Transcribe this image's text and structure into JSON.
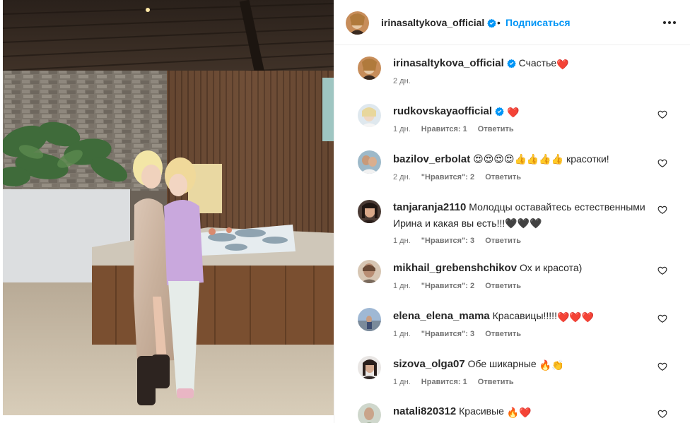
{
  "header": {
    "username": "irinasaltykova_official",
    "follow_label": "Подписаться",
    "separator": "•"
  },
  "comments": [
    {
      "username": "irinasaltykova_official",
      "text": "Счастье",
      "emoji": "❤️",
      "time": "2 дн.",
      "likes": "",
      "reply": "",
      "verified": true,
      "caption": true
    },
    {
      "username": "rudkovskayaofficial",
      "text": "",
      "emoji": "❤️",
      "time": "1 дн.",
      "likes": "Нравится: 1",
      "reply": "Ответить",
      "verified": true
    },
    {
      "username": "bazilov_erbolat",
      "text": "😍😍😍😍👍👍👍👍 красотки!",
      "emoji": "",
      "time": "2 дн.",
      "likes": "\"Нравится\": 2",
      "reply": "Ответить"
    },
    {
      "username": "tanjaranja2110",
      "text": "Молодцы оставайтесь естественными Ирина и какая вы есть!!!🖤🖤🖤",
      "emoji": "",
      "time": "1 дн.",
      "likes": "\"Нравится\": 3",
      "reply": "Ответить"
    },
    {
      "username": "mikhail_grebenshchikov",
      "text": "Ох и красота)",
      "emoji": "",
      "time": "1 дн.",
      "likes": "\"Нравится\": 2",
      "reply": "Ответить"
    },
    {
      "username": "elena_elena_mama",
      "text": "Красавицы!!!!!",
      "emoji": "❤️❤️❤️",
      "time": "1 дн.",
      "likes": "\"Нравится\": 3",
      "reply": "Ответить"
    },
    {
      "username": "sizova_olga07",
      "text": "Обе шикарные",
      "emoji": "🔥👏",
      "time": "1 дн.",
      "likes": "Нравится: 1",
      "reply": "Ответить"
    },
    {
      "username": "natali820312",
      "text": "Красивые",
      "emoji": "🔥❤️",
      "time": "",
      "likes": "",
      "reply": ""
    }
  ],
  "icons": {
    "verified": "verified-badge-icon",
    "more": "more-options-icon",
    "like": "heart-outline-icon"
  },
  "colors": {
    "link_blue": "#0095f6",
    "verified_blue": "#0095f6",
    "meta_gray": "#737373",
    "heart_red": "#ed1c24"
  }
}
